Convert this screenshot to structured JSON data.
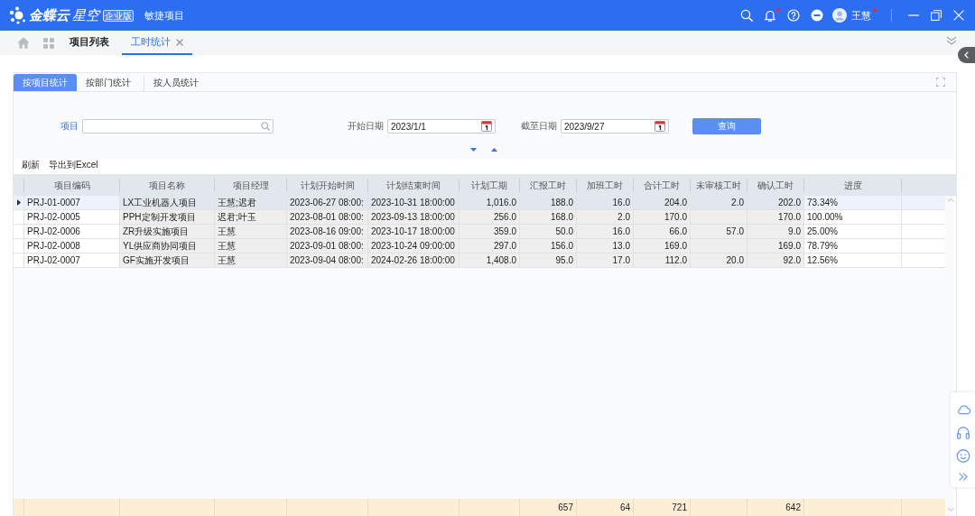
{
  "topbar": {
    "brand": "金蝶云",
    "product": "星空",
    "edition": "企业版",
    "title": "敏捷项目",
    "notifications_unread": true,
    "user": {
      "name": "王慧",
      "unread": true
    }
  },
  "page_tabs": [
    {
      "label": "项目列表",
      "selected": false,
      "closable": false
    },
    {
      "label": "工时统计",
      "selected": true,
      "closable": true
    }
  ],
  "view_tabs": [
    {
      "label": "按项目统计",
      "selected": true
    },
    {
      "label": "按部门统计",
      "selected": false
    },
    {
      "label": "按人员统计",
      "selected": false
    }
  ],
  "filters": [
    {
      "kind": "lookup",
      "label": "项目"
    },
    {
      "kind": "date",
      "label": "开始日期",
      "value": "2023/1/1"
    },
    {
      "kind": "date",
      "label": "截至日期",
      "value": "2023/9/27"
    }
  ],
  "query_button": "查询",
  "toolbar": [
    "刷新",
    "导出到Excel"
  ],
  "table": {
    "columns": [
      {
        "label": "项目编码",
        "kind": "text",
        "shaded": false
      },
      {
        "label": "项目名称",
        "kind": "text",
        "shaded": true
      },
      {
        "label": "项目经理",
        "kind": "text",
        "shaded": true
      },
      {
        "label": "计划开始时间",
        "kind": "text",
        "shaded": true
      },
      {
        "label": "计划结束时间",
        "kind": "text",
        "shaded": true
      },
      {
        "label": "计划工期",
        "kind": "number",
        "shaded": true
      },
      {
        "label": "汇报工时",
        "kind": "number",
        "shaded": true
      },
      {
        "label": "加班工时",
        "kind": "number",
        "shaded": true
      },
      {
        "label": "合计工时",
        "kind": "number",
        "shaded": true
      },
      {
        "label": "未审核工时",
        "kind": "number",
        "shaded": true
      },
      {
        "label": "确认工时",
        "kind": "number",
        "shaded": true
      },
      {
        "label": "进度",
        "kind": "text",
        "shaded": false
      }
    ],
    "rows": [
      {
        "selected": true,
        "project_code": "PRJ-01-0007",
        "project_name": "LX工业机器人项目",
        "project_manager": "王慧;迟君",
        "planned_start": "2023-06-27 08:00:",
        "planned_end": "2023-10-31 18:00:00",
        "planned_duration": "1,016.0",
        "reported_hours": "188.0",
        "overtime_hours": "16.0",
        "total_hours": "204.0",
        "unaudited_hours": "2.0",
        "confirmed_hours": "202.0",
        "progress": "73.34%"
      },
      {
        "selected": false,
        "project_code": "PRJ-02-0005",
        "project_name": "PPH定制开发项目",
        "project_manager": "迟君;叶玉",
        "planned_start": "2023-08-01 08:00:",
        "planned_end": "2023-09-13 18:00:00",
        "planned_duration": "256.0",
        "reported_hours": "168.0",
        "overtime_hours": "2.0",
        "total_hours": "170.0",
        "confirmed_hours": "170.0",
        "progress": "100.00%"
      },
      {
        "selected": false,
        "project_code": "PRJ-02-0006",
        "project_name": "ZR升级实施项目",
        "project_manager": "王慧",
        "planned_start": "2023-08-16 09:00:",
        "planned_end": "2023-10-17 18:00:00",
        "planned_duration": "359.0",
        "reported_hours": "50.0",
        "overtime_hours": "16.0",
        "total_hours": "66.0",
        "unaudited_hours": "57.0",
        "confirmed_hours": "9.0",
        "progress": "25.00%"
      },
      {
        "selected": false,
        "project_code": "PRJ-02-0008",
        "project_name": "YL供应商协同项目",
        "project_manager": "王慧",
        "planned_start": "2023-09-01 08:00:",
        "planned_end": "2023-10-24 09:00:00",
        "planned_duration": "297.0",
        "reported_hours": "156.0",
        "overtime_hours": "13.0",
        "total_hours": "169.0",
        "confirmed_hours": "169.0",
        "progress": "78.79%"
      },
      {
        "selected": false,
        "project_code": "PRJ-02-0007",
        "project_name": "GF实施开发项目",
        "project_manager": "王慧",
        "planned_start": "2023-09-04 08:00:",
        "planned_end": "2024-02-26 18:00:00",
        "planned_duration": "1,408.0",
        "reported_hours": "95.0",
        "overtime_hours": "17.0",
        "total_hours": "112.0",
        "unaudited_hours": "20.0",
        "confirmed_hours": "92.0",
        "progress": "12.56%"
      }
    ],
    "totals": {
      "reported_hours": "657",
      "overtime_hours": "64",
      "total_hours": "721",
      "confirmed_hours": "642"
    }
  }
}
